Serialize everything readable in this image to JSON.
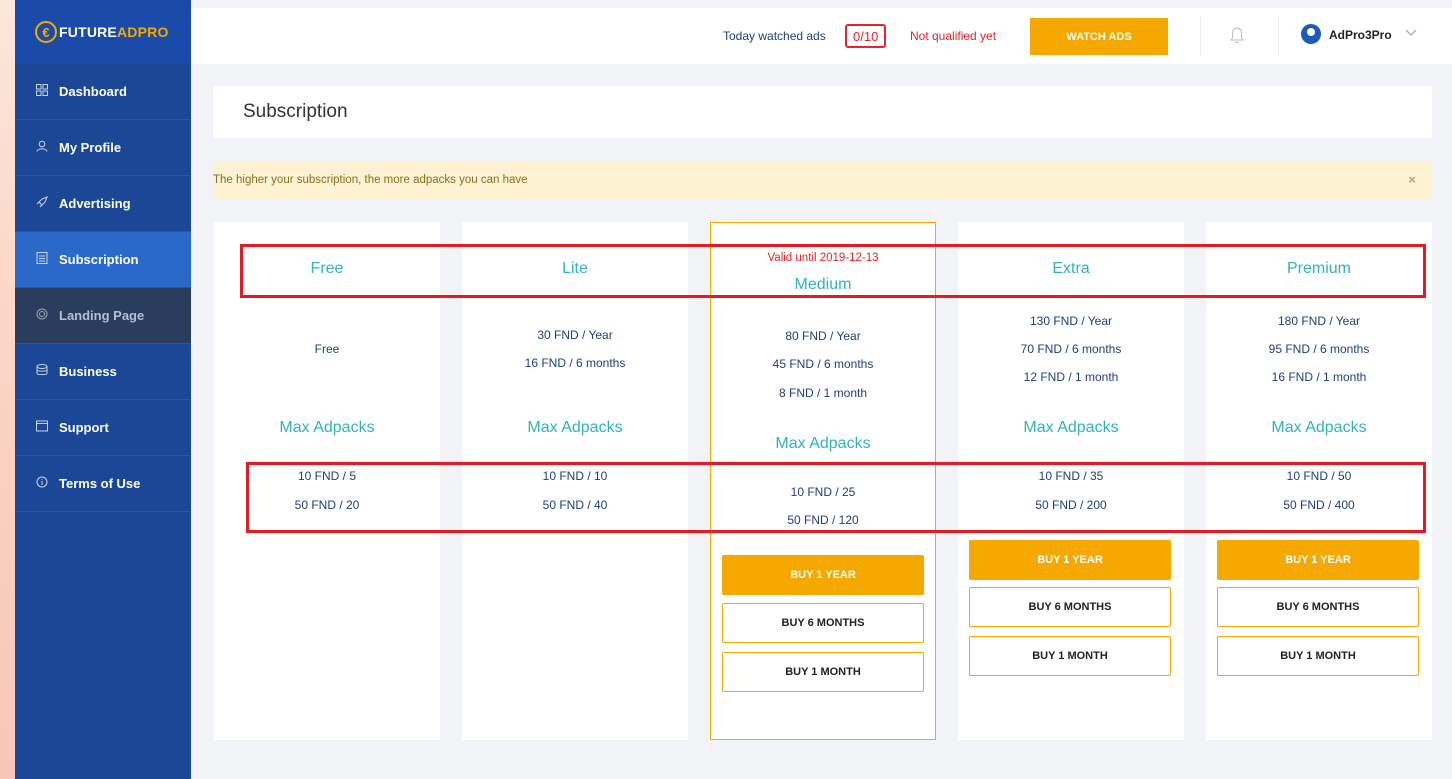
{
  "logo": {
    "mark": "€",
    "text_a": "FUTURE",
    "text_b": "ADPRO"
  },
  "sidebar": {
    "items": [
      {
        "label": "Dashboard",
        "icon": "grid-icon"
      },
      {
        "label": "My Profile",
        "icon": "user-icon"
      },
      {
        "label": "Advertising",
        "icon": "rocket-icon"
      },
      {
        "label": "Subscription",
        "icon": "list-icon"
      },
      {
        "label": "Landing Page",
        "icon": "target-icon"
      },
      {
        "label": "Business",
        "icon": "database-icon"
      },
      {
        "label": "Support",
        "icon": "window-icon"
      },
      {
        "label": "Terms of Use",
        "icon": "info-icon"
      }
    ]
  },
  "topbar": {
    "watched_label": "Today watched ads",
    "watched_count": "0/10",
    "qualification_status": "Not qualified yet",
    "watch_button": "WATCH ADS",
    "username": "AdPro3Pro"
  },
  "page": {
    "title": "Subscription",
    "alert": "The higher your subscription, the more adpacks you can have",
    "alert_close": "×"
  },
  "plans": {
    "free": {
      "name": "Free",
      "prices": [
        "Free"
      ],
      "max_title": "Max Adpacks",
      "adpacks": [
        "10 FND / 5",
        "50 FND / 20"
      ]
    },
    "lite": {
      "name": "Lite",
      "prices": [
        "30 FND / Year",
        "16 FND / 6 months"
      ],
      "max_title": "Max Adpacks",
      "adpacks": [
        "10 FND / 10",
        "50 FND / 40"
      ]
    },
    "medium": {
      "valid_until": "Valid until 2019-12-13",
      "name": "Medium",
      "prices": [
        "80 FND / Year",
        "45 FND / 6 months",
        "8 FND / 1 month"
      ],
      "max_title": "Max Adpacks",
      "adpacks": [
        "10 FND / 25",
        "50 FND / 120"
      ],
      "buttons": [
        "BUY 1 YEAR",
        "BUY 6 MONTHS",
        "BUY 1 MONTH"
      ]
    },
    "extra": {
      "name": "Extra",
      "prices": [
        "130 FND / Year",
        "70 FND / 6 months",
        "12 FND / 1 month"
      ],
      "max_title": "Max Adpacks",
      "adpacks": [
        "10 FND / 35",
        "50 FND / 200"
      ],
      "buttons": [
        "BUY 1 YEAR",
        "BUY 6 MONTHS",
        "BUY 1 MONTH"
      ]
    },
    "premium": {
      "name": "Premium",
      "prices": [
        "180 FND / Year",
        "95 FND / 6 months",
        "16 FND / 1 month"
      ],
      "max_title": "Max Adpacks",
      "adpacks": [
        "10 FND / 50",
        "50 FND / 400"
      ],
      "buttons": [
        "BUY 1 YEAR",
        "BUY 6 MONTHS",
        "BUY 1 MONTH"
      ]
    }
  },
  "colors": {
    "accent": "#f5a800",
    "sidebar": "#1c4796",
    "sidebar_active": "#2a68c9",
    "plan_title": "#2fb3bf",
    "alert_red": "#e0262f",
    "highlight_red": "#e21b24"
  }
}
